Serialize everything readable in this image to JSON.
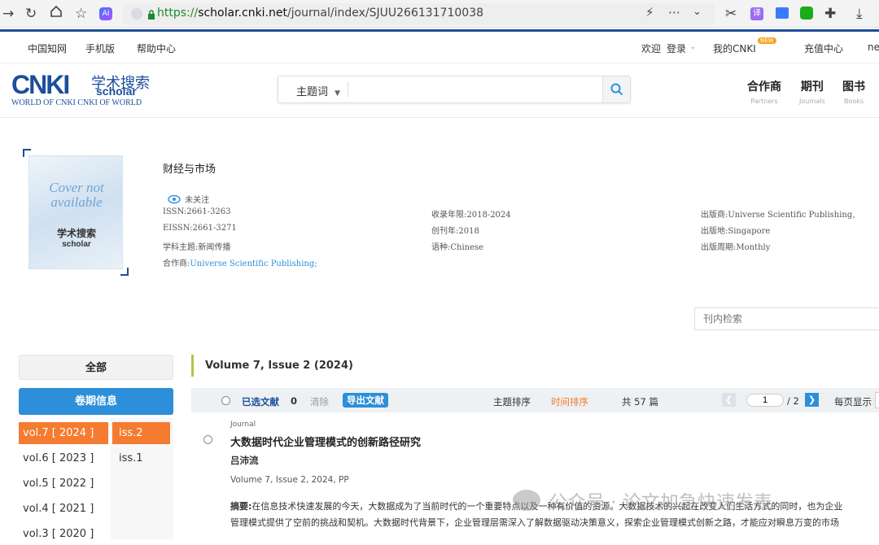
{
  "browser": {
    "url_protocol": "https://",
    "url_host": "scholar.cnki.net",
    "url_path": "/journal/index/SJUU266131710038"
  },
  "topnav": {
    "left": [
      "中国知网",
      "手机版",
      "帮助中心"
    ],
    "welcome": "欢迎",
    "login": "登录",
    "my_cnki": "我的CNKI",
    "new_badge": "NEW",
    "recharge": "充值中心",
    "cut": "ne"
  },
  "logo": {
    "main": "CNKI",
    "cn": "学术搜索",
    "scholar": "scholar",
    "tagline": "WORLD OF CNKI CNKI OF WORLD"
  },
  "search": {
    "type_label": "主题词"
  },
  "header_links": [
    {
      "label": "合作商",
      "sub": "Partners"
    },
    {
      "label": "期刊",
      "sub": "Journals"
    },
    {
      "label": "图书",
      "sub": "Books"
    }
  ],
  "cover": {
    "line1": "Cover not",
    "line2": "available",
    "logo_cn": "学术搜索",
    "logo_en": "scholar"
  },
  "journal": {
    "title": "财经与市场",
    "follow": "未关注",
    "issn": "ISSN:2661-3263",
    "eissn": "EISSN:2661-3271",
    "subject": "学科主题:新闻传播",
    "partner_label": "合作商:",
    "partner_value": "Universe Scientific Publishing;",
    "years": "收录年限:2018-2024",
    "founded": "创刊年:2018",
    "language": "语种:Chinese",
    "publisher": "出版商:Universe Scientific Publishing,",
    "place": "出版地:Singapore",
    "frequency": "出版周期:Monthly"
  },
  "inner_search_placeholder": "刊内检索",
  "left_panel": {
    "all": "全部",
    "volume_info": "卷期信息",
    "volumes": [
      "vol.7 [ 2024 ]",
      "vol.6 [ 2023 ]",
      "vol.5 [ 2022 ]",
      "vol.4 [ 2021 ]",
      "vol.3 [ 2020 ]"
    ],
    "issues": [
      "iss.2",
      "iss.1"
    ]
  },
  "issue_heading": "Volume 7, Issue 2 (2024)",
  "toolbar": {
    "selected": "已选文献",
    "selected_count": "0",
    "clear": "清除",
    "export": "导出文献",
    "sort_topic": "主题排序",
    "sort_time": "时间排序",
    "total": "共 57 篇",
    "page": "1",
    "page_total": "/ 2",
    "per_page": "每页显示"
  },
  "article": {
    "type": "Journal",
    "title": "大数据时代企业管理模式的创新路径研究",
    "author": "吕沛流",
    "meta": "Volume 7, Issue 2, 2024, PP",
    "abstract_label": "摘要:",
    "abstract_line1": "在信息技术快速发展的今天，大数据成为了当前时代的一个重要特点以及一种有价值的资源。大数据技术的兴起在改变人们生活方式的同时，也为企业",
    "abstract_line2": "管理模式提供了空前的挑战和契机。大数据时代背景下，企业管理层需深入了解数据驱动决策意义，探索企业管理模式创新之路，才能应对瞬息万变的市场"
  },
  "watermark": "公众号 · 论文加急快速发表",
  "colors": {
    "accent_blue": "#2d8fd9",
    "brand_navy": "#1c4e9c",
    "active_orange": "#f47b30",
    "toolbar_bg": "#eef1f4"
  }
}
